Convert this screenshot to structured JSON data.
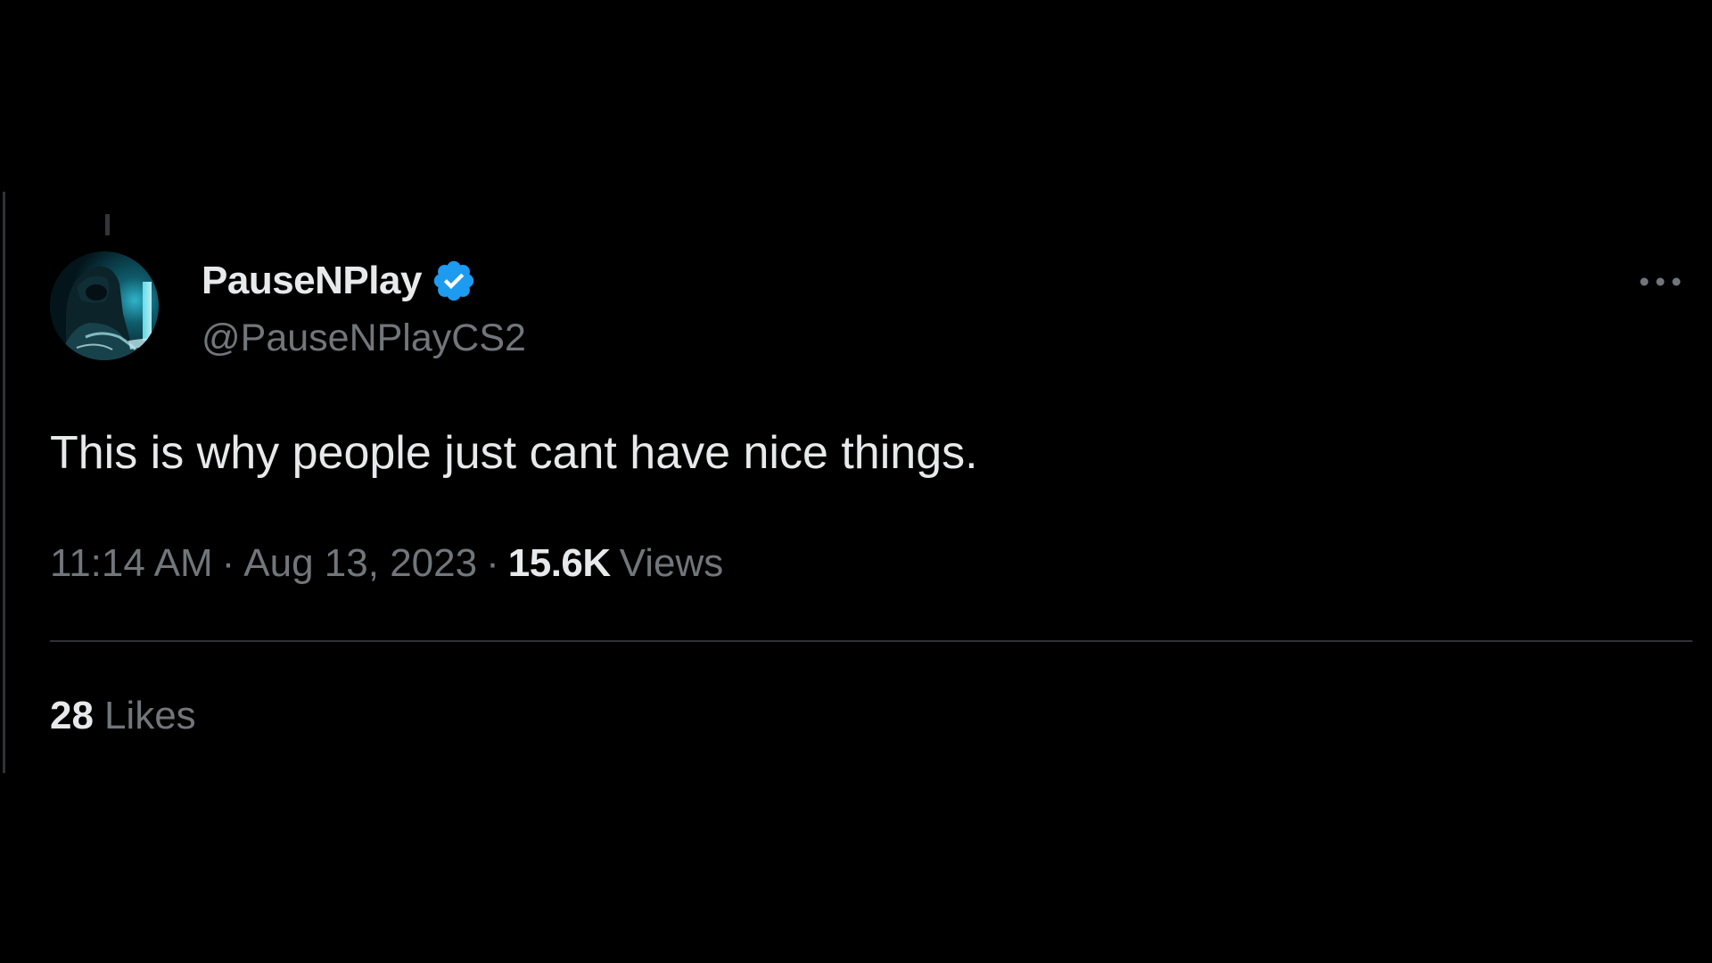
{
  "author": {
    "display_name": "PauseNPlay",
    "handle": "@PauseNPlayCS2",
    "verified": true,
    "avatar_icon": "hooded-figure-avatar"
  },
  "tweet": {
    "text": "This is why people just cant have nice things.",
    "time": "11:14 AM",
    "date": "Aug 13, 2023",
    "separator": "·",
    "views_count": "15.6K",
    "views_label": "Views"
  },
  "engagement": {
    "likes_count": "28",
    "likes_label": "Likes"
  },
  "icons": {
    "more": "more-horizontal-icon",
    "verified": "verified-badge-icon"
  },
  "colors": {
    "background": "#000000",
    "primary_text": "#e7e9ea",
    "secondary_text": "#71767b",
    "divider": "#2f3336",
    "verified_blue": "#1d9bf0"
  }
}
